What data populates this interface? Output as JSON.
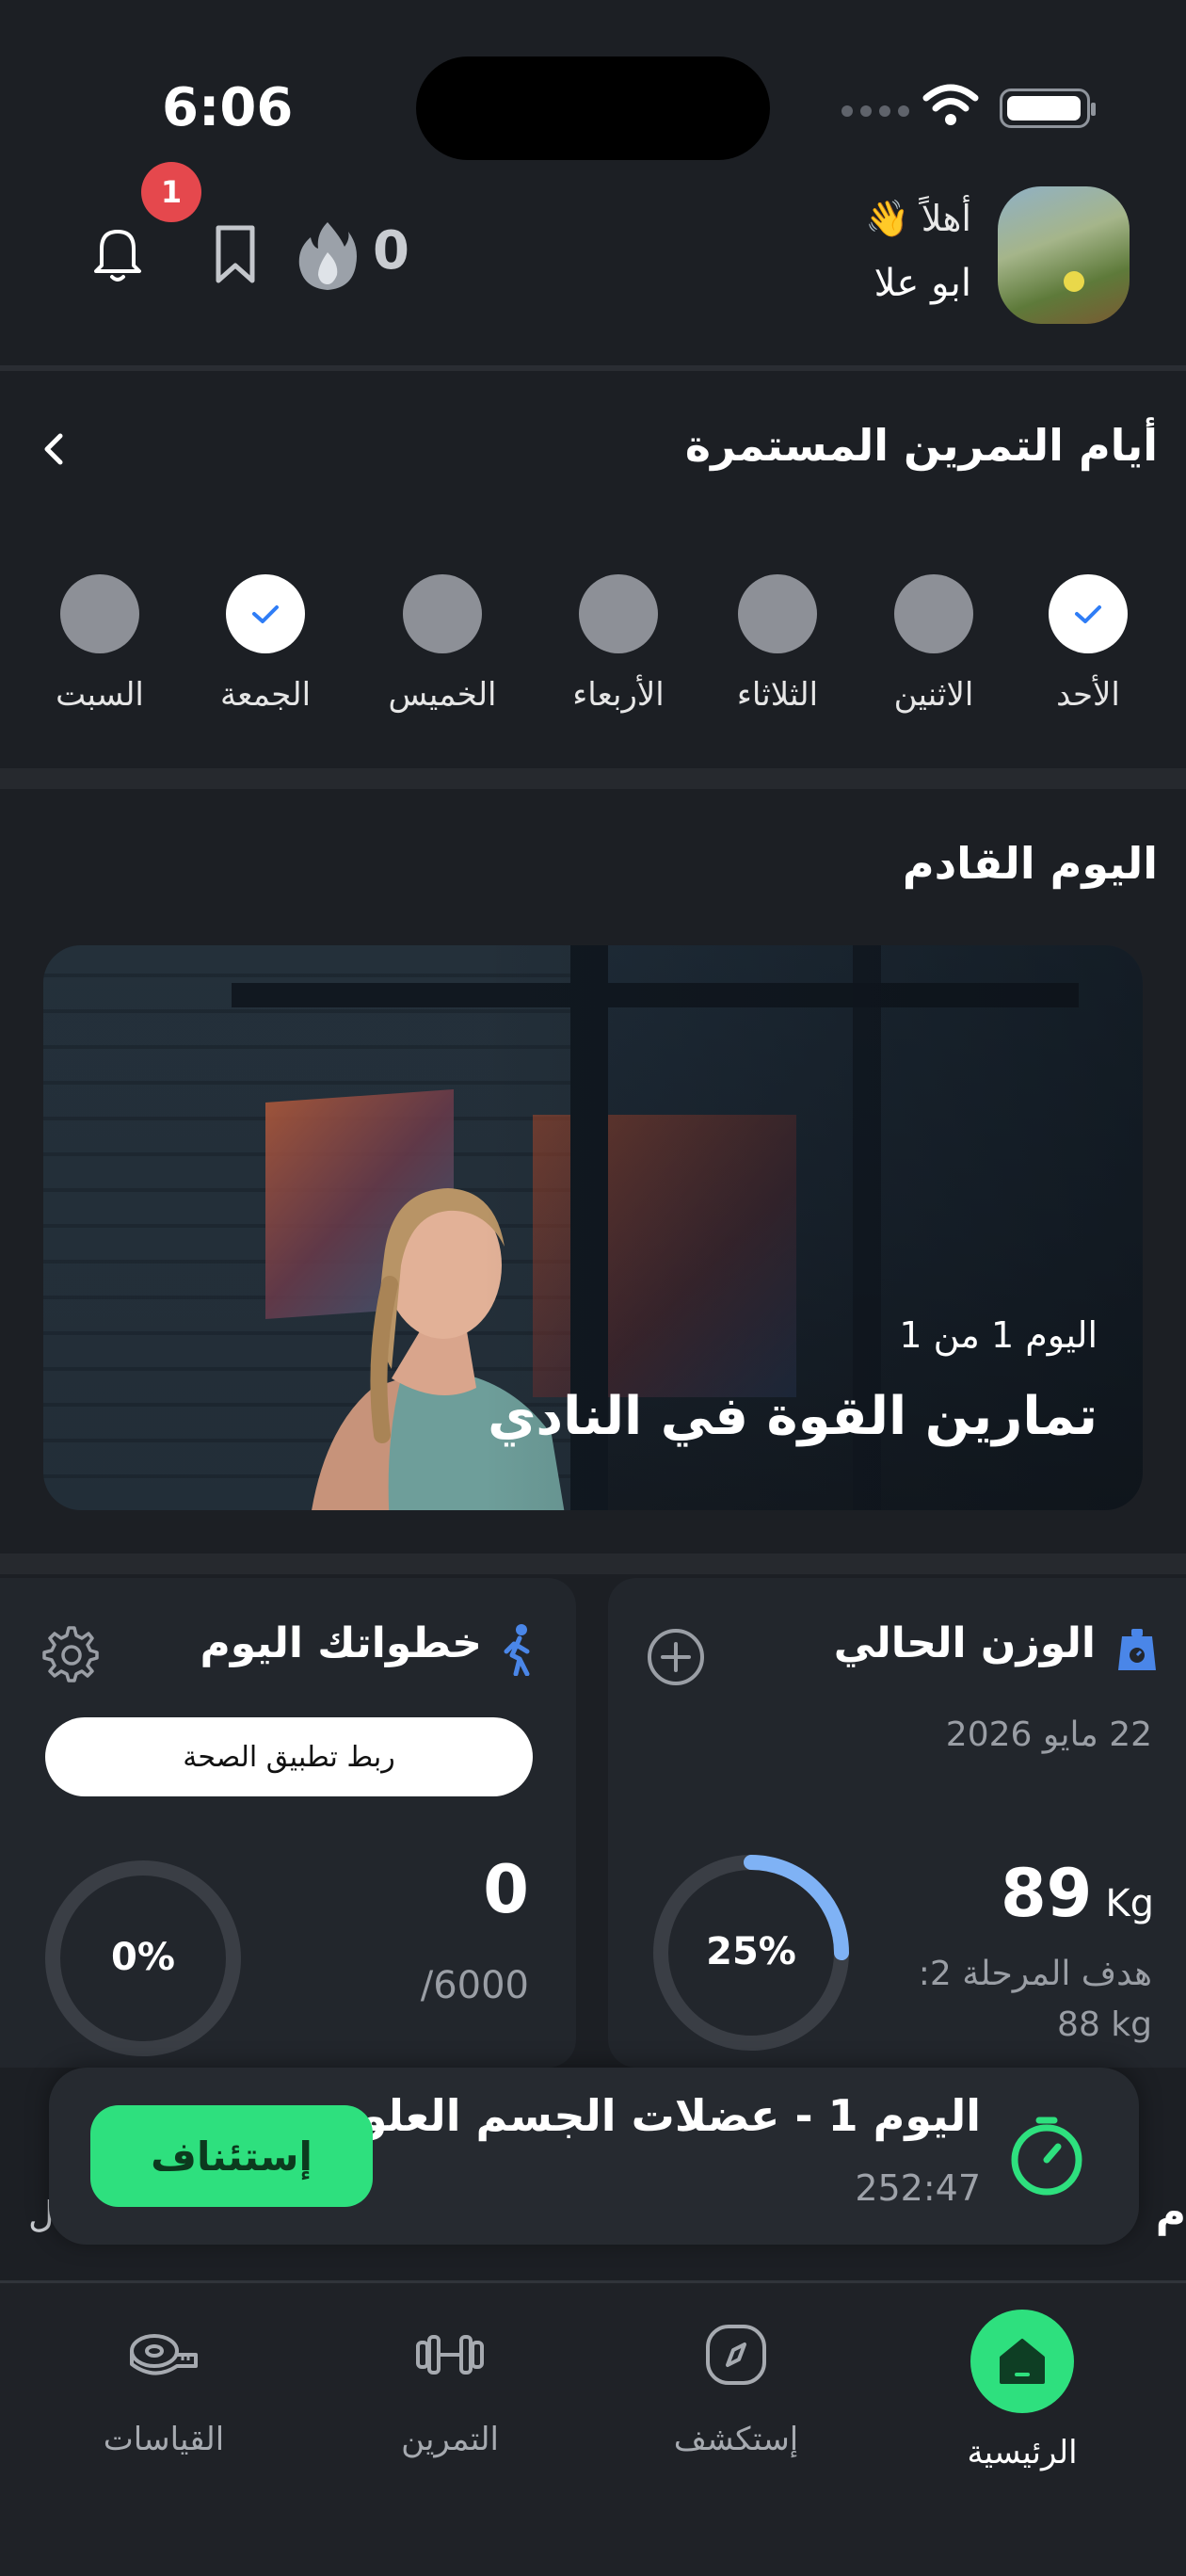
{
  "status_bar": {
    "time": "6:06"
  },
  "header": {
    "greeting": "أهلاً 👋",
    "user_name": "ابو علا",
    "notification_count": "1",
    "streak_count": "0"
  },
  "streak_days": {
    "title": "أيام التمرين المستمرة",
    "days": [
      {
        "label": "الأحد",
        "done": true
      },
      {
        "label": "الاثنين",
        "done": false
      },
      {
        "label": "الثلاثاء",
        "done": false
      },
      {
        "label": "الأربعاء",
        "done": false
      },
      {
        "label": "الخميس",
        "done": false
      },
      {
        "label": "الجمعة",
        "done": true
      },
      {
        "label": "السبت",
        "done": false
      }
    ]
  },
  "next_day": {
    "title": "اليوم القادم",
    "card_subtitle": "اليوم 1 من 1",
    "card_title": "تمارين القوة في النادي"
  },
  "weight": {
    "title": "الوزن الحالي",
    "date": "22 مايو 2026",
    "progress_label": "25%",
    "progress": 0.25,
    "value": "89",
    "unit": "Kg",
    "goal_label": "هدف المرحلة 2:",
    "goal_value": "88 kg"
  },
  "steps": {
    "title": "خطواتك اليوم",
    "connect_label": "ربط تطبيق الصحة",
    "progress_label": "0%",
    "progress": 0,
    "value": "0",
    "goal": "/6000"
  },
  "resume": {
    "title": "اليوم 1 - عضلات الجسم العلوي",
    "elapsed": "252:47",
    "button_label": "إستئناف",
    "peek_right": "م",
    "peek_left": "ل"
  },
  "nav": {
    "items": [
      {
        "label": "الرئيسية",
        "icon": "home-icon",
        "active": true
      },
      {
        "label": "إستكشف",
        "icon": "compass-icon",
        "active": false
      },
      {
        "label": "التمرين",
        "icon": "dumbbell-icon",
        "active": false
      },
      {
        "label": "القياسات",
        "icon": "tape-measure-icon",
        "active": false
      }
    ]
  },
  "colors": {
    "accent": "#2ee07e",
    "badge": "#e5484d",
    "check": "#2f7df6",
    "ring": "#7fb2f5"
  }
}
